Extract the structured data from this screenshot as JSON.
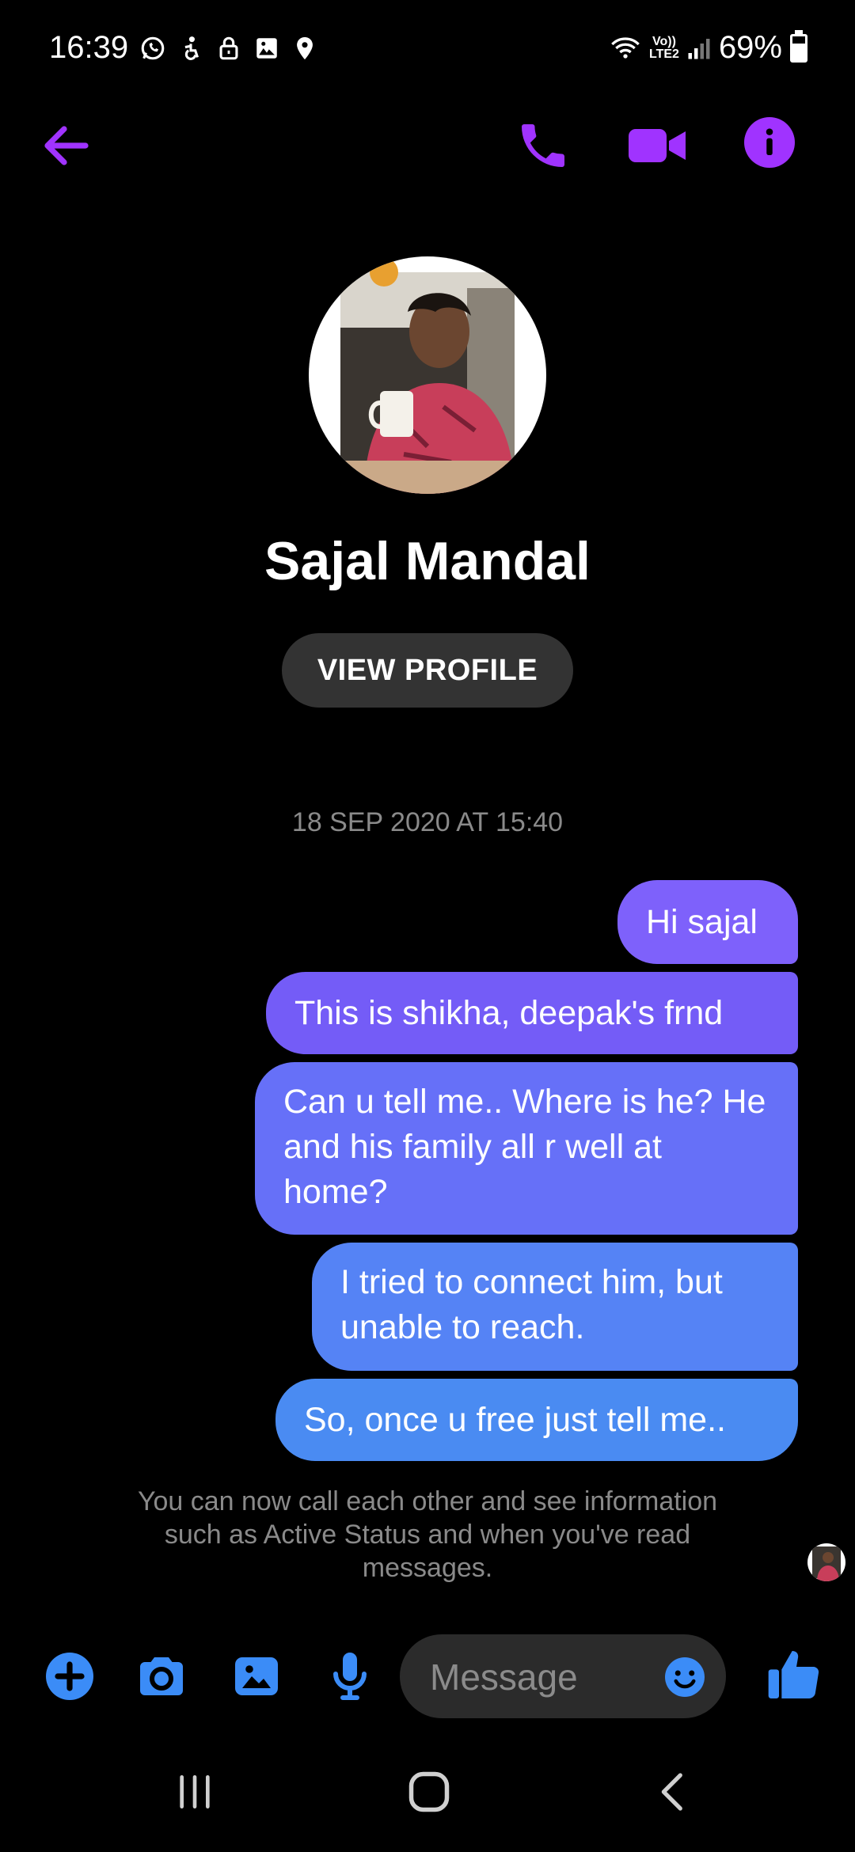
{
  "status_bar": {
    "time": "16:39",
    "network_top": "Vo))",
    "network_bottom": "LTE2",
    "battery": "69%",
    "battery_level": 0.69,
    "icons_left": [
      "whatsapp-icon",
      "accessibility-icon",
      "lock-icon",
      "image-icon",
      "location-icon"
    ],
    "icons_right": [
      "wifi-icon",
      "signal-icon",
      "battery-icon"
    ]
  },
  "header": {
    "accent_color": "#a033ff",
    "icons": [
      "back-arrow-icon",
      "phone-icon",
      "video-camera-icon",
      "info-icon"
    ]
  },
  "profile": {
    "name": "Sajal Mandal",
    "view_profile_label": "VIEW PROFILE"
  },
  "conversation": {
    "timestamp": "18 SEP 2020 AT 15:40",
    "messages": [
      {
        "text": "Hi sajal",
        "color": "#7e61fb"
      },
      {
        "text": "This is shikha, deepak's frnd",
        "color": "#745cf7"
      },
      {
        "text": "Can u tell me.. Where is he? He and his family all r well at home?",
        "color": "#6670f8"
      },
      {
        "text": "I tried to connect him, but unable  to reach.",
        "color": "#5583f5"
      },
      {
        "text": "So, once u free just tell me..",
        "color": "#4a8bf2"
      }
    ],
    "notice": "You can now call each other and see information such as Active Status and when you've read messages."
  },
  "composer": {
    "accent_color": "#3b8cf7",
    "placeholder": "Message",
    "icons": [
      "plus-icon",
      "camera-icon",
      "gallery-icon",
      "microphone-icon",
      "emoji-icon",
      "thumbs-up-icon"
    ]
  },
  "nav_bar": {
    "icons": [
      "recents-icon",
      "home-icon",
      "back-icon"
    ]
  }
}
